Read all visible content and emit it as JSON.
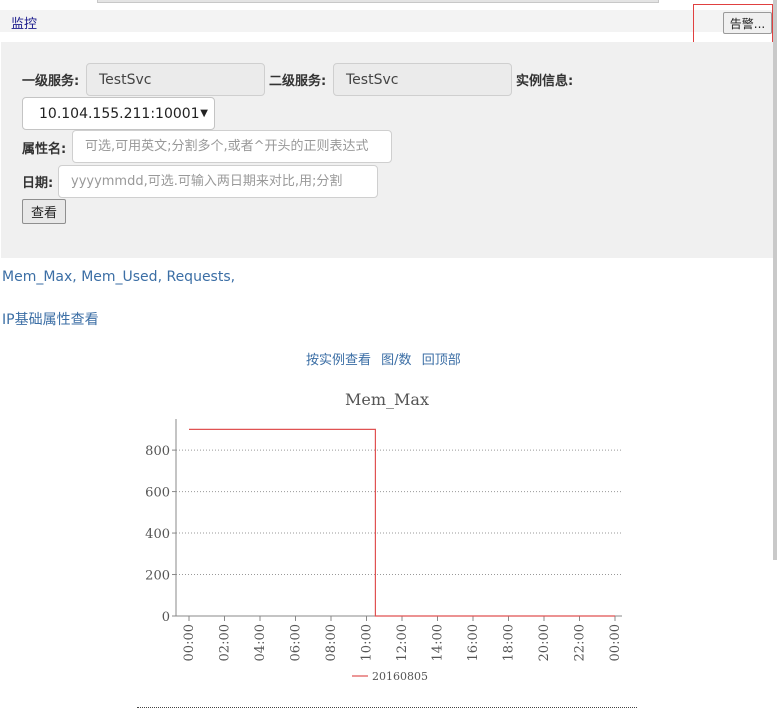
{
  "header": {
    "monitor_label": "监控",
    "alarm_button": "告警..."
  },
  "form": {
    "service1_label": "一级服务:",
    "service1_value": "TestSvc",
    "service2_label": "二级服务:",
    "service2_value": "TestSvc",
    "instance_label": "实例信息:",
    "instance_value": "10.104.155.211:10001",
    "attr_label": "属性名:",
    "attr_placeholder": "可选,可用英文;分割多个,或者^开头的正则表达式",
    "date_label": "日期:",
    "date_placeholder": "yyyymmdd,可选.可输入两日期来对比,用;分割",
    "view_button": "查看"
  },
  "attributes": {
    "items": [
      "Mem_Max",
      "Mem_Used",
      "Requests"
    ],
    "separator": ", ",
    "trailing": ","
  },
  "ip_link": "IP基础属性查看",
  "nav": {
    "by_instance": "按实例查看",
    "chart_or_number": "图/数",
    "back_to_top": "回顶部"
  },
  "colors": {
    "series": "#e05252",
    "link": "#3b6ea5",
    "panel_bg": "#f0f0f0",
    "alarm_border": "#e04040"
  },
  "chart_data": {
    "type": "line",
    "title": "Mem_Max",
    "xlabel": "",
    "ylabel": "",
    "x_ticks": [
      "00:00",
      "02:00",
      "04:00",
      "06:00",
      "08:00",
      "10:00",
      "12:00",
      "14:00",
      "16:00",
      "18:00",
      "20:00",
      "22:00",
      "00:00"
    ],
    "y_ticks": [
      "0",
      "200",
      "400",
      "600",
      "800"
    ],
    "ylim": [
      0,
      950
    ],
    "xlim_hours": [
      0,
      24
    ],
    "grid": "horizontal-dotted",
    "legend_placement": "bottom-center",
    "series": [
      {
        "name": "20160805",
        "color": "#e05252",
        "points": [
          {
            "x": 0,
            "y": 900
          },
          {
            "x": 10.5,
            "y": 900
          },
          {
            "x": 10.5,
            "y": 0
          },
          {
            "x": 24,
            "y": 0
          }
        ]
      }
    ]
  }
}
